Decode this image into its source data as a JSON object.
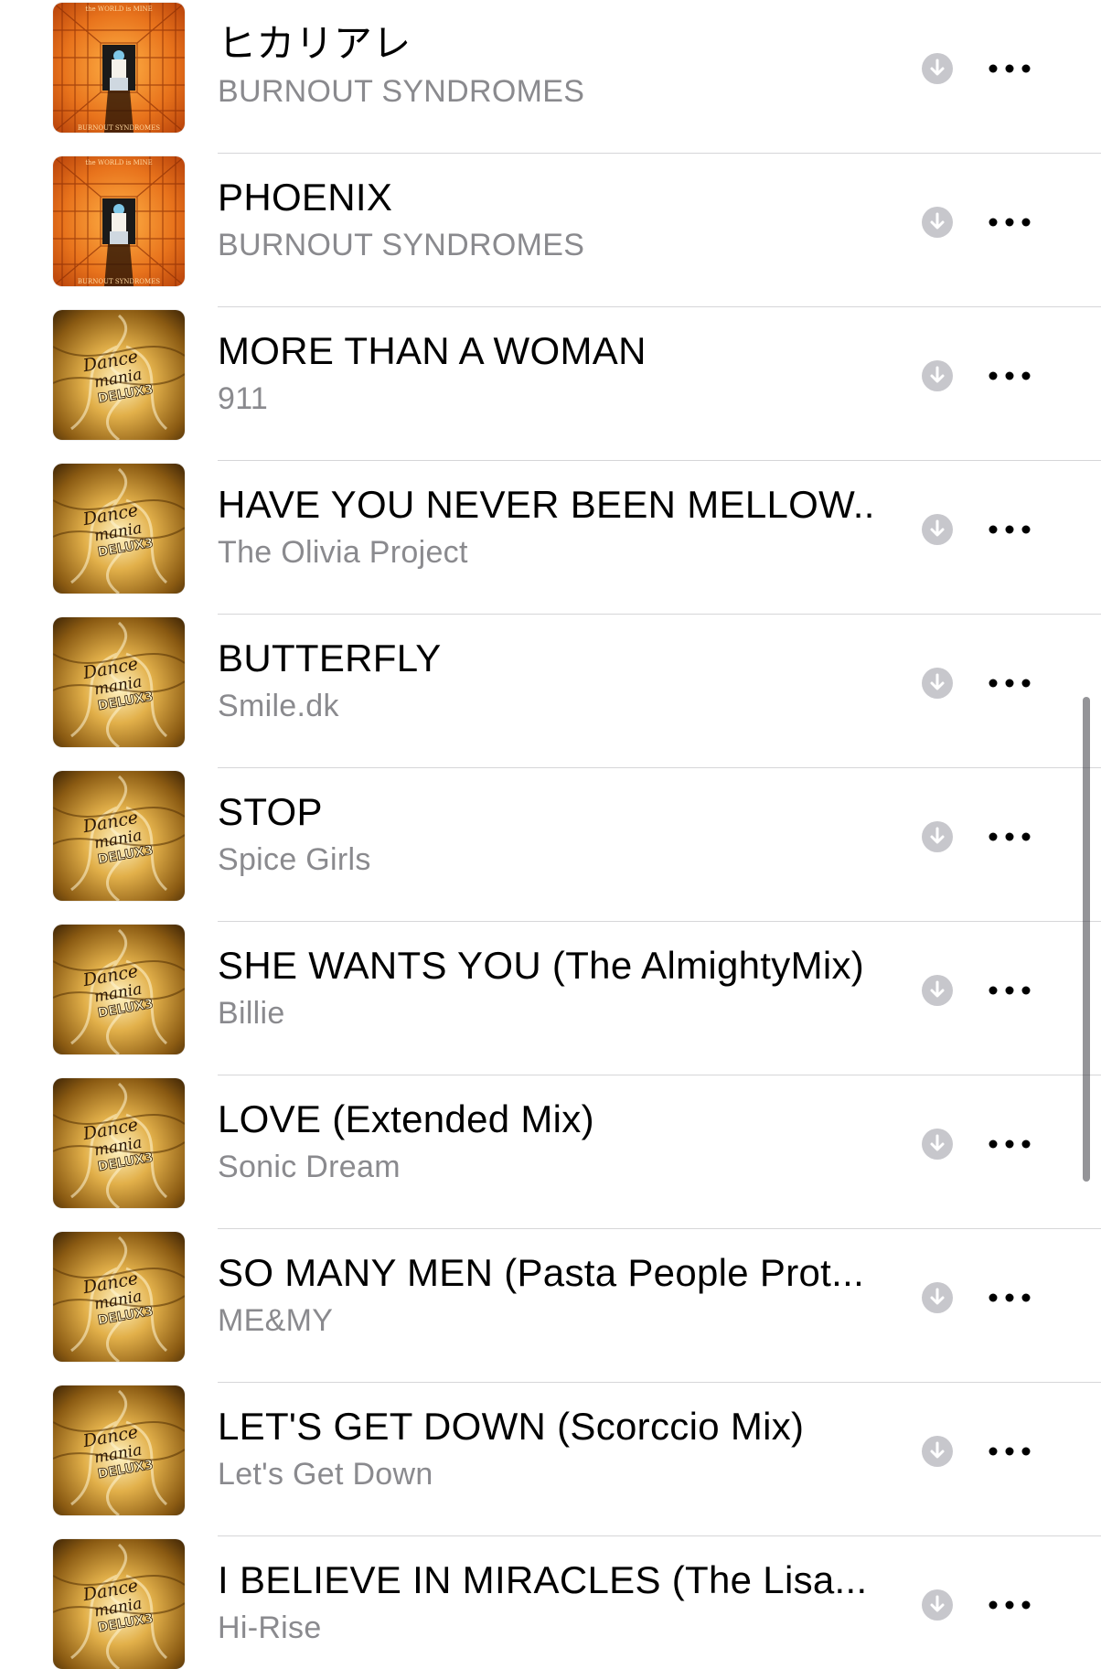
{
  "songs": [
    {
      "title": "ヒカリアレ",
      "artist": "BURNOUT SYNDROMES",
      "artwork": "burnout-syndromes-album-art"
    },
    {
      "title": "PHOENIX",
      "artist": "BURNOUT SYNDROMES",
      "artwork": "burnout-syndromes-album-art"
    },
    {
      "title": "MORE THAN A WOMAN",
      "artist": "911",
      "artwork": "dancemania-delux-3-album-art"
    },
    {
      "title": "HAVE YOU NEVER BEEN MELLOW...",
      "artist": "The Olivia Project",
      "artwork": "dancemania-delux-3-album-art"
    },
    {
      "title": "BUTTERFLY",
      "artist": "Smile.dk",
      "artwork": "dancemania-delux-3-album-art"
    },
    {
      "title": "STOP",
      "artist": "Spice Girls",
      "artwork": "dancemania-delux-3-album-art"
    },
    {
      "title": "SHE WANTS YOU (The AlmightyMix)",
      "artist": "Billie",
      "artwork": "dancemania-delux-3-album-art"
    },
    {
      "title": "LOVE (Extended Mix)",
      "artist": "Sonic Dream",
      "artwork": "dancemania-delux-3-album-art"
    },
    {
      "title": "SO MANY MEN (Pasta People Prot...",
      "artist": "ME&MY",
      "artwork": "dancemania-delux-3-album-art"
    },
    {
      "title": "LET'S GET DOWN (Scorccio Mix)",
      "artist": "Let's Get Down",
      "artwork": "dancemania-delux-3-album-art"
    },
    {
      "title": "I BELIEVE IN MIRACLES (The Lisa...",
      "artist": "Hi-Rise",
      "artwork": "dancemania-delux-3-album-art"
    }
  ],
  "icons": {
    "download": "download-icon",
    "more": "more-options-icon"
  },
  "colors": {
    "title": "#000000",
    "artist": "#8a8a8e",
    "download_icon": "#c7c7cc",
    "separator": "#d6d6d8",
    "dancemania_gold": "#c9922a",
    "burnout_orange": "#e8731c"
  },
  "artwork_text": {
    "burnout_top": "the WORLD is MINE",
    "burnout_bottom": "BURNOUT SYNDROMES",
    "dancemania_line1": "Dance",
    "dancemania_line2": "mania",
    "dancemania_line3": "DELUX3"
  }
}
